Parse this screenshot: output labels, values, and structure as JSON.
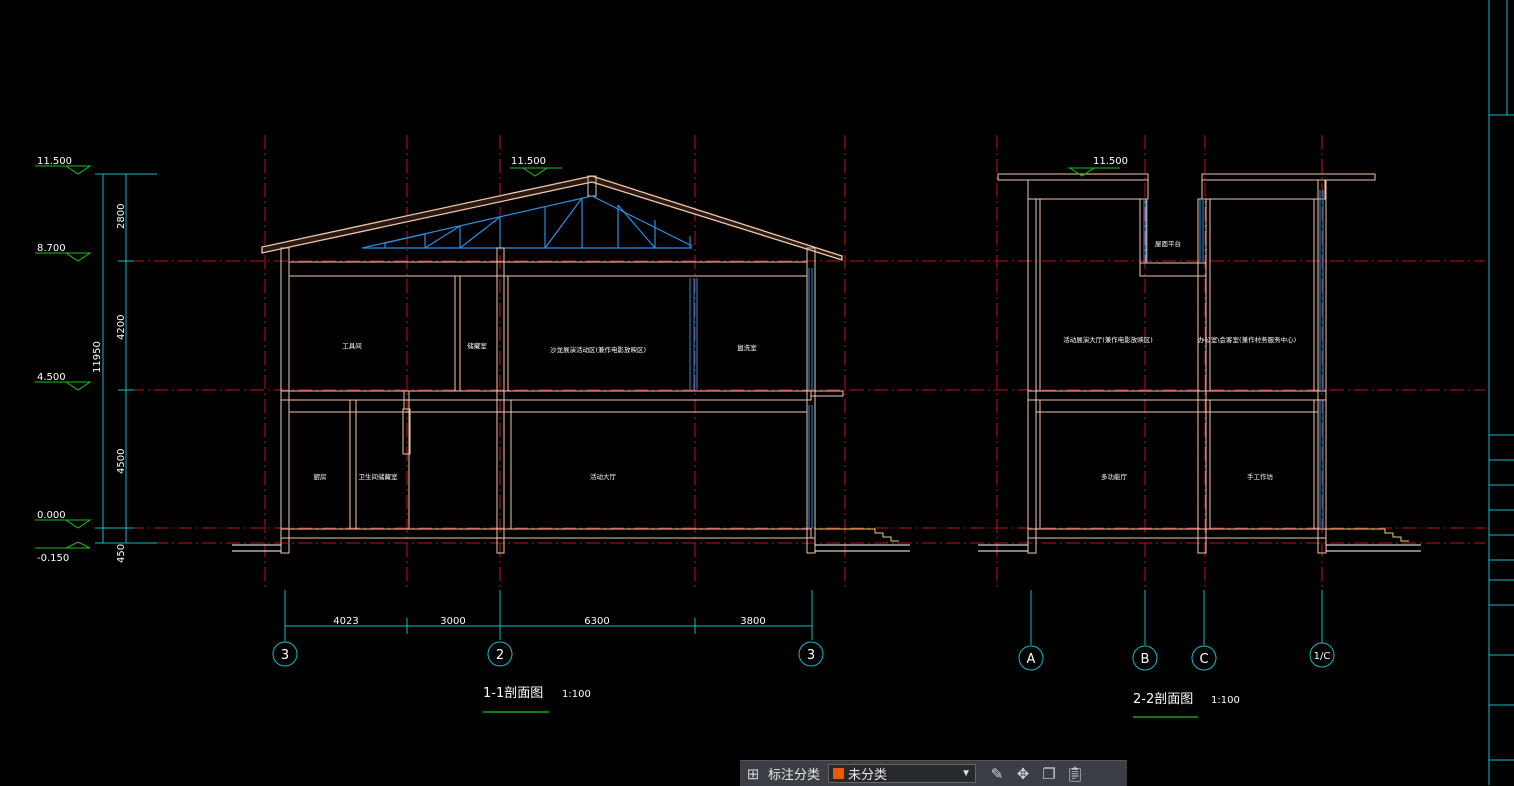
{
  "drawing": {
    "section1": {
      "title": "1-1剖面图",
      "scale": "1:100",
      "levels": [
        "11.500",
        "8.700",
        "4.500",
        "0.000",
        "-0.150"
      ],
      "ridge_level": "11.500",
      "dims_vertical": [
        "2800",
        "4200",
        "4500",
        "450"
      ],
      "total_height": "11950",
      "dims_horizontal": [
        "4023",
        "3000",
        "6300",
        "3800"
      ],
      "axes": [
        "3",
        "2",
        "3"
      ],
      "rooms_upper": [
        "工具间",
        "储藏室",
        "沙龙展演活动区(兼作电影放映区)",
        "盥洗室"
      ],
      "rooms_lower": [
        "厨房",
        "卫生间储藏室",
        "活动大厅"
      ]
    },
    "section2": {
      "title": "2-2剖面图",
      "scale": "1:100",
      "top_level": "11.500",
      "axes": [
        "A",
        "B",
        "C",
        "1/C"
      ],
      "rooms_upper": [
        "活动展演大厅(兼作电影放映区)",
        "办公室\\会客室(兼作村务服务中心)"
      ],
      "label_roof": "屋面平台",
      "rooms_lower": [
        "多功能厅",
        "手工作坊"
      ]
    }
  },
  "toolbar": {
    "annotation_label": "标注分类",
    "category_value": "未分类",
    "swatch_color": "#e8590c",
    "icons": [
      "grid-icon",
      "edit-icon",
      "move-icon",
      "copy-icon",
      "paste-icon"
    ]
  }
}
